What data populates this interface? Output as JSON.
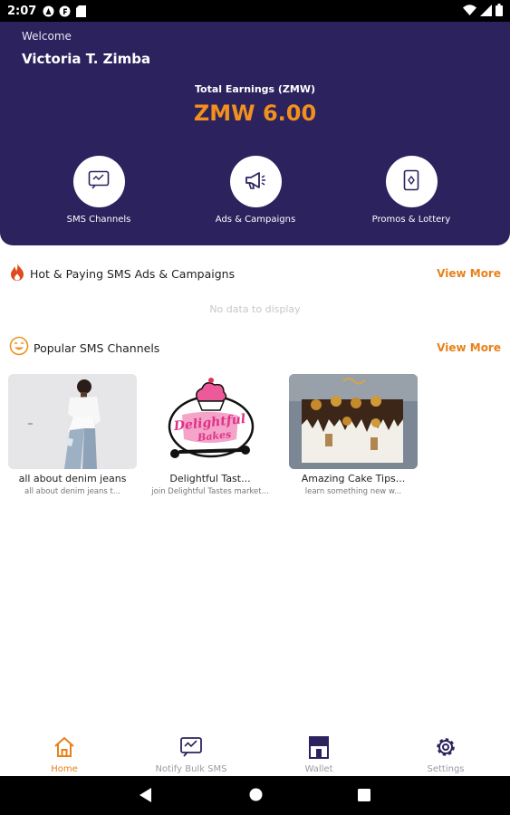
{
  "status_bar": {
    "time": "2:07"
  },
  "header": {
    "welcome": "Welcome",
    "user_name": "Victoria T. Zimba",
    "earnings_label": "Total Earnings (ZMW)",
    "earnings_value": "ZMW 6.00"
  },
  "quick_actions": [
    {
      "label": "SMS Channels",
      "icon": "sms-icon"
    },
    {
      "label": "Ads & Campaigns",
      "icon": "megaphone-icon"
    },
    {
      "label": "Promos & Lottery",
      "icon": "ticket-icon"
    }
  ],
  "hot_section": {
    "title": "Hot & Paying SMS Ads & Campaigns",
    "view_more": "View More",
    "empty_text": "No data to display",
    "icon": "fire-icon"
  },
  "popular_section": {
    "title": "Popular SMS Channels",
    "view_more": "View More",
    "icon": "smile-icon"
  },
  "channels": [
    {
      "title": "all about denim jeans",
      "subtitle": "all about denim jeans t..."
    },
    {
      "title": "Delightful Tast...",
      "subtitle": "join Delightful Tastes market..."
    },
    {
      "title": "Amazing Cake Tips...",
      "subtitle": "learn something new w..."
    }
  ],
  "logo_text": "Delightful Bakes",
  "bottom_nav": [
    {
      "label": "Home",
      "icon": "home-icon",
      "active": true
    },
    {
      "label": "Notify Bulk SMS",
      "icon": "sms-icon",
      "active": false
    },
    {
      "label": "Wallet",
      "icon": "store-icon",
      "active": false
    },
    {
      "label": "Settings",
      "icon": "gear-icon",
      "active": false
    }
  ],
  "colors": {
    "header_bg": "#2c225e",
    "accent": "#e8811b",
    "fire": "#e04a1f"
  }
}
